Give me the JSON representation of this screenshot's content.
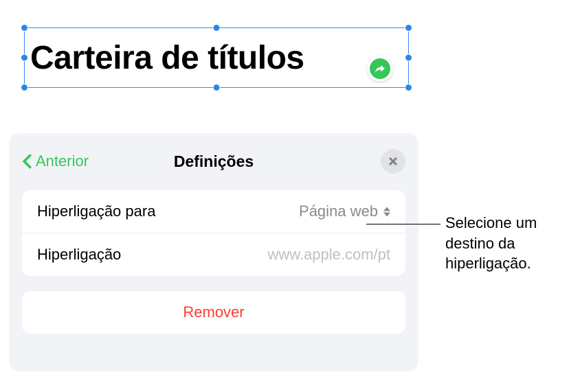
{
  "textbox": {
    "content": "Carteira de títulos"
  },
  "popover": {
    "back_label": "Anterior",
    "title": "Definições",
    "rows": {
      "link_to": {
        "label": "Hiperligação para",
        "value": "Página web"
      },
      "link": {
        "label": "Hiperligação",
        "placeholder": "www.apple.com/pt"
      }
    },
    "remove_label": "Remover"
  },
  "callout": {
    "text": "Selecione um destino da hiperligação."
  }
}
